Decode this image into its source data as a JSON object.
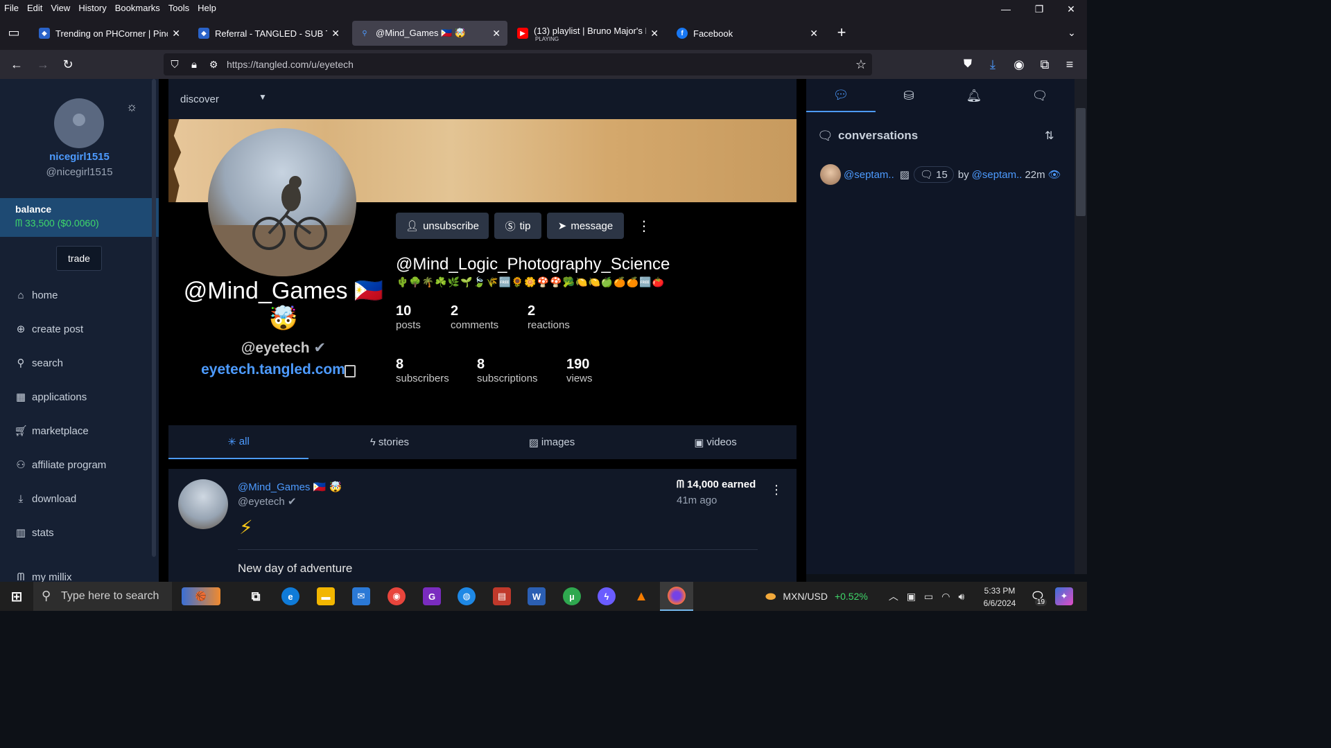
{
  "menubar": {
    "items": [
      "File",
      "Edit",
      "View",
      "History",
      "Bookmarks",
      "Tools",
      "Help"
    ]
  },
  "tabs": [
    {
      "title": "Trending on PHCorner | Pinoy In",
      "icon": "phcorner-icon",
      "color": "#2a63c9"
    },
    {
      "title": "Referral - TANGLED - SUB TO S",
      "icon": "tangled-icon",
      "color": "#2a63c9"
    },
    {
      "title": "@Mind_Games 🇵🇭 🤯",
      "icon": "tangled-icon",
      "color": "#4d9bff"
    },
    {
      "title": "(13) playlist | Bruno Major's Be",
      "subtitle": "PLAYING",
      "icon": "youtube-icon",
      "color": "#ff0000"
    },
    {
      "title": "Facebook",
      "icon": "facebook-icon",
      "color": "#1877f2"
    }
  ],
  "navbar": {
    "url": "https://tangled.com/u/eyetech"
  },
  "sidebar": {
    "username": "nicegirl1515",
    "handle": "@nicegirl1515",
    "balance_label": "balance",
    "balance_value": "ᗰ 33,500 ($0.0060)",
    "trade_label": "trade",
    "items": [
      {
        "label": "home",
        "icon": "home-icon"
      },
      {
        "label": "create post",
        "icon": "plus-circle-icon"
      },
      {
        "label": "search",
        "icon": "search-icon"
      },
      {
        "label": "applications",
        "icon": "grid-icon"
      },
      {
        "label": "marketplace",
        "icon": "cart-icon"
      },
      {
        "label": "affiliate program",
        "icon": "affiliate-icon"
      },
      {
        "label": "download",
        "icon": "download-icon"
      },
      {
        "label": "stats",
        "icon": "stats-icon"
      },
      {
        "label": "my millix",
        "icon": "millix-icon"
      }
    ]
  },
  "main": {
    "discover_label": "discover",
    "buttons": {
      "unsubscribe": "unsubscribe",
      "tip": "tip",
      "message": "message"
    },
    "display_name": "@Mind_Games 🇵🇭 🤯",
    "handle": "@eyetech",
    "site": "eyetech.tangled.com",
    "full_name": "@Mind_Logic_Photography_Science",
    "emoji_row": "🌵🌳🌴☘️🌿🌱🍃🌾🆓🌻🌼🍄🍄🥦🍋🍋🍏🍊🍊🆓🍅",
    "stats_row1": [
      {
        "n": "10",
        "l": "posts"
      },
      {
        "n": "2",
        "l": "comments"
      },
      {
        "n": "2",
        "l": "reactions"
      }
    ],
    "stats_row2": [
      {
        "n": "8",
        "l": "subscribers"
      },
      {
        "n": "8",
        "l": "subscriptions"
      },
      {
        "n": "190",
        "l": "views"
      }
    ],
    "content_tabs": [
      {
        "label": "all",
        "icon": "asterisk-icon"
      },
      {
        "label": "stories",
        "icon": "bolt-icon"
      },
      {
        "label": "images",
        "icon": "image-icon"
      },
      {
        "label": "videos",
        "icon": "video-icon"
      }
    ],
    "post": {
      "user": "@Mind_Games 🇵🇭 🤯",
      "handle": "@eyetech",
      "earned": "14,000 earned",
      "ago": "41m ago",
      "emoji": "⚡",
      "text": "New day of adventure"
    }
  },
  "rpanel": {
    "title": "conversations",
    "conv": {
      "user": "@septam..",
      "comments": "15",
      "by": "by",
      "by_user": "@septam..",
      "time": "22m"
    }
  },
  "taskbar": {
    "search_placeholder": "Type here to search",
    "currency": "MXN/USD",
    "change": "+0.52%",
    "time": "5:33 PM",
    "date": "6/6/2024",
    "notif_count": "19"
  }
}
